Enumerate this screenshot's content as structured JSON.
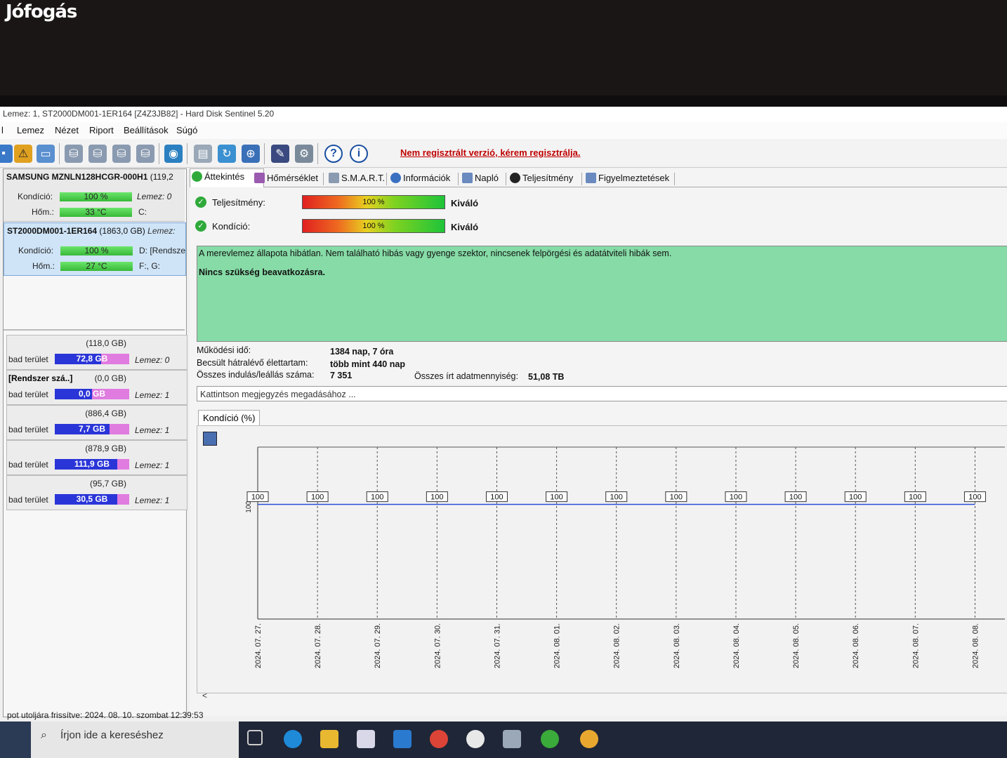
{
  "watermark": "Jófogás",
  "window": {
    "title": "Lemez: 1, ST2000DM001-1ER164 [Z4Z3JB82]  -  Hard Disk Sentinel 5.20"
  },
  "menu": [
    "l",
    "Lemez",
    "Nézet",
    "Riport",
    "Beállítások",
    "Súgó"
  ],
  "toolbar": {
    "icons": [
      "alert-icon",
      "disk-info-icon",
      "disk-test-icon-1",
      "disk-test-icon-2",
      "disk-test-icon-3",
      "disk-test-icon-4",
      "web-icon",
      "report-icon",
      "refresh-icon",
      "globe-icon",
      "benchmark-icon",
      "settings-icon",
      "help-icon",
      "info-icon"
    ],
    "register_link": "Nem regisztrált verzió, kérem regisztrálja."
  },
  "disks": [
    {
      "name": "SAMSUNG MZNLN128HCGR-000H1",
      "size": "(119,2",
      "lemez": "",
      "condition_label": "Kondíció:",
      "condition": "100 %",
      "condition_pct": 100,
      "temp_label": "Hőm.:",
      "temp": "33 °C",
      "right1": "Lemez: 0",
      "right2": "C:"
    },
    {
      "name": "ST2000DM001-1ER164",
      "size": "(1863,0 GB)",
      "lemez": "Lemez:",
      "condition_label": "Kondíció:",
      "condition": "100 %",
      "condition_pct": 100,
      "temp_label": "Hőm.:",
      "temp": "27 °C",
      "right1": "D: [Rendsze",
      "right2": "F:, G:"
    }
  ],
  "partitions": [
    {
      "size": "(118,0 GB)",
      "label": "bad terület",
      "free": "72,8 GB",
      "used_pct": 62,
      "lemez": "Lemez: 0"
    },
    {
      "size": "(0,0 GB)",
      "name": "[Rendszer szá..]",
      "label": "bad terület",
      "free": "0,0 GB",
      "used_pct": 50,
      "lemez": "Lemez: 1"
    },
    {
      "size": "(886,4 GB)",
      "label": "bad terület",
      "free": "7,7 GB",
      "used_pct": 74,
      "lemez": "Lemez: 1"
    },
    {
      "size": "(878,9 GB)",
      "label": "bad terület",
      "free": "111,9 GB",
      "used_pct": 84,
      "lemez": "Lemez: 1"
    },
    {
      "size": "(95,7 GB)",
      "label": "bad terület",
      "free": "30,5 GB",
      "used_pct": 84,
      "lemez": "Lemez: 1"
    }
  ],
  "tabs": [
    "Áttekintés",
    "Hőmérséklet",
    "S.M.A.R.T.",
    "Információk",
    "Napló",
    "Teljesítmény",
    "Figyelmeztetések"
  ],
  "overview": {
    "performance_label": "Teljesítmény:",
    "performance_value": "100 %",
    "performance_pct": 100,
    "performance_rating": "Kiváló",
    "condition_label": "Kondíció:",
    "condition_value": "100 %",
    "condition_pct": 100,
    "condition_rating": "Kiváló",
    "status_text": "A merevlemez állapota hibátlan. Nem található hibás vagy gyenge szektor, nincsenek felpörgési és adatátviteli hibák sem.",
    "action_text": "Nincs szükség beavatkozásra.",
    "uptime_label": "Működési idő:",
    "uptime_value": "1384 nap, 7 óra",
    "lifetime_label": "Becsült hátralévő élettartam:",
    "lifetime_value": "több mint 440 nap",
    "startstop_label": "Összes indulás/leállás száma:",
    "startstop_value": "7 351",
    "written_label": "Összes írt adatmennyiség:",
    "written_value": "51,08 TB",
    "note_placeholder": "Kattintson megjegyzés megadásához ...",
    "chart_tab": "Kondíció  (%)",
    "scroll_left": "<"
  },
  "chart_data": {
    "type": "line",
    "title": "",
    "ylabel": "100",
    "x": [
      "2024. 07. 27.",
      "2024. 07. 28.",
      "2024. 07. 29.",
      "2024. 07. 30.",
      "2024. 07. 31.",
      "2024. 08. 01.",
      "2024. 08. 02.",
      "2024. 08. 03.",
      "2024. 08. 04.",
      "2024. 08. 05.",
      "2024. 08. 06.",
      "2024. 08. 07.",
      "2024. 08. 08."
    ],
    "series": [
      {
        "name": "",
        "values": [
          100,
          100,
          100,
          100,
          100,
          100,
          100,
          100,
          100,
          100,
          100,
          100,
          100
        ]
      }
    ],
    "data_labels": [
      "100",
      "100",
      "100",
      "100",
      "100",
      "100",
      "100",
      "100",
      "100",
      "100",
      "100",
      "100",
      "100"
    ],
    "grid": true,
    "line_color": "#2b4fd8"
  },
  "statusbar": "pot utoljára frissítve: 2024. 08. 10. szombat 12:39:53",
  "taskbar": {
    "search_placeholder": "Írjon ide a kereséshez",
    "apps": [
      "task-view-icon",
      "edge-icon",
      "explorer-icon",
      "store-icon",
      "mail-icon",
      "chrome-icon",
      "keys-icon",
      "hdsentinel-icon",
      "utorrent-icon",
      "app-icon"
    ]
  }
}
